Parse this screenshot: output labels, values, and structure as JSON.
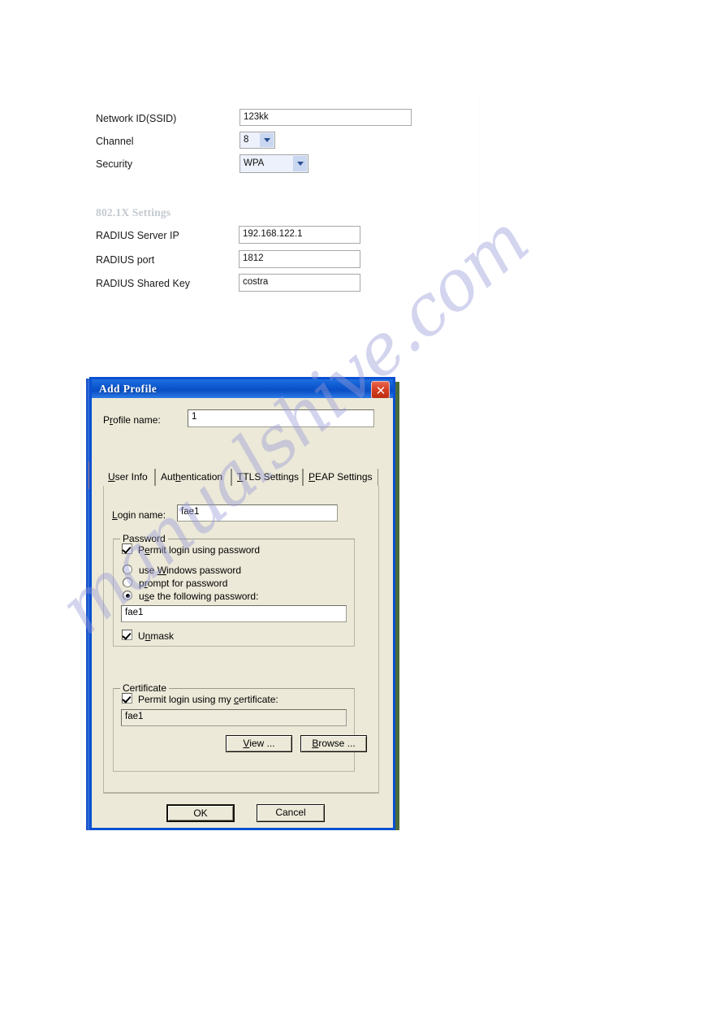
{
  "page": {
    "watermark": "manualshive.com"
  },
  "web_form": {
    "rows": [
      {
        "label": "Network ID(SSID)",
        "value": "123kk",
        "control": "text"
      },
      {
        "label": "Channel",
        "value": "8",
        "control": "select"
      },
      {
        "label": "Security",
        "value": "WPA",
        "control": "select"
      }
    ],
    "section_heading": "802.1X Settings",
    "radius_rows": [
      {
        "label": "RADIUS Server IP",
        "value": "192.168.122.1",
        "control": "text"
      },
      {
        "label": "RADIUS port",
        "value": "1812",
        "control": "text"
      },
      {
        "label": "RADIUS Shared Key",
        "value": "costra",
        "control": "text"
      }
    ]
  },
  "dialog": {
    "title": "Add Profile",
    "close_icon": "close-icon",
    "profile_name_label": "Profile name:",
    "profile_name_value": "1",
    "tabs": [
      {
        "label": "User Info",
        "mnemonic": "U",
        "active": true
      },
      {
        "label": "Authentication",
        "mnemonic": "h",
        "active": false
      },
      {
        "label": "TTLS Settings",
        "mnemonic": "T",
        "active": false
      },
      {
        "label": "PEAP Settings",
        "mnemonic": "P",
        "active": false
      }
    ],
    "login_name_label": "Login name:",
    "login_name_value": "fae1",
    "password_group": {
      "title": "Password",
      "permit_checkbox": {
        "label": "Permit login using password",
        "checked": true
      },
      "radios": [
        {
          "label": "use Windows password",
          "selected": false
        },
        {
          "label": "prompt for password",
          "selected": false
        },
        {
          "label": "use the following password:",
          "selected": true
        }
      ],
      "password_value": "fae1",
      "unmask_checkbox": {
        "label": "Unmask",
        "checked": true
      }
    },
    "certificate_group": {
      "title": "Certificate",
      "permit_checkbox": {
        "label": "Permit login using my certificate:",
        "checked": true
      },
      "certificate_value": "fae1",
      "view_button": "View ...",
      "browse_button": "Browse ..."
    },
    "ok_button": "OK",
    "cancel_button": "Cancel"
  },
  "colors": {
    "titlebar_blue": "#0b55cc",
    "dialog_face": "#ece9d8",
    "close_red": "#d83f23",
    "section_heading_gray": "#c3c9cf",
    "dropdown_blue": "#c9d7f0"
  }
}
